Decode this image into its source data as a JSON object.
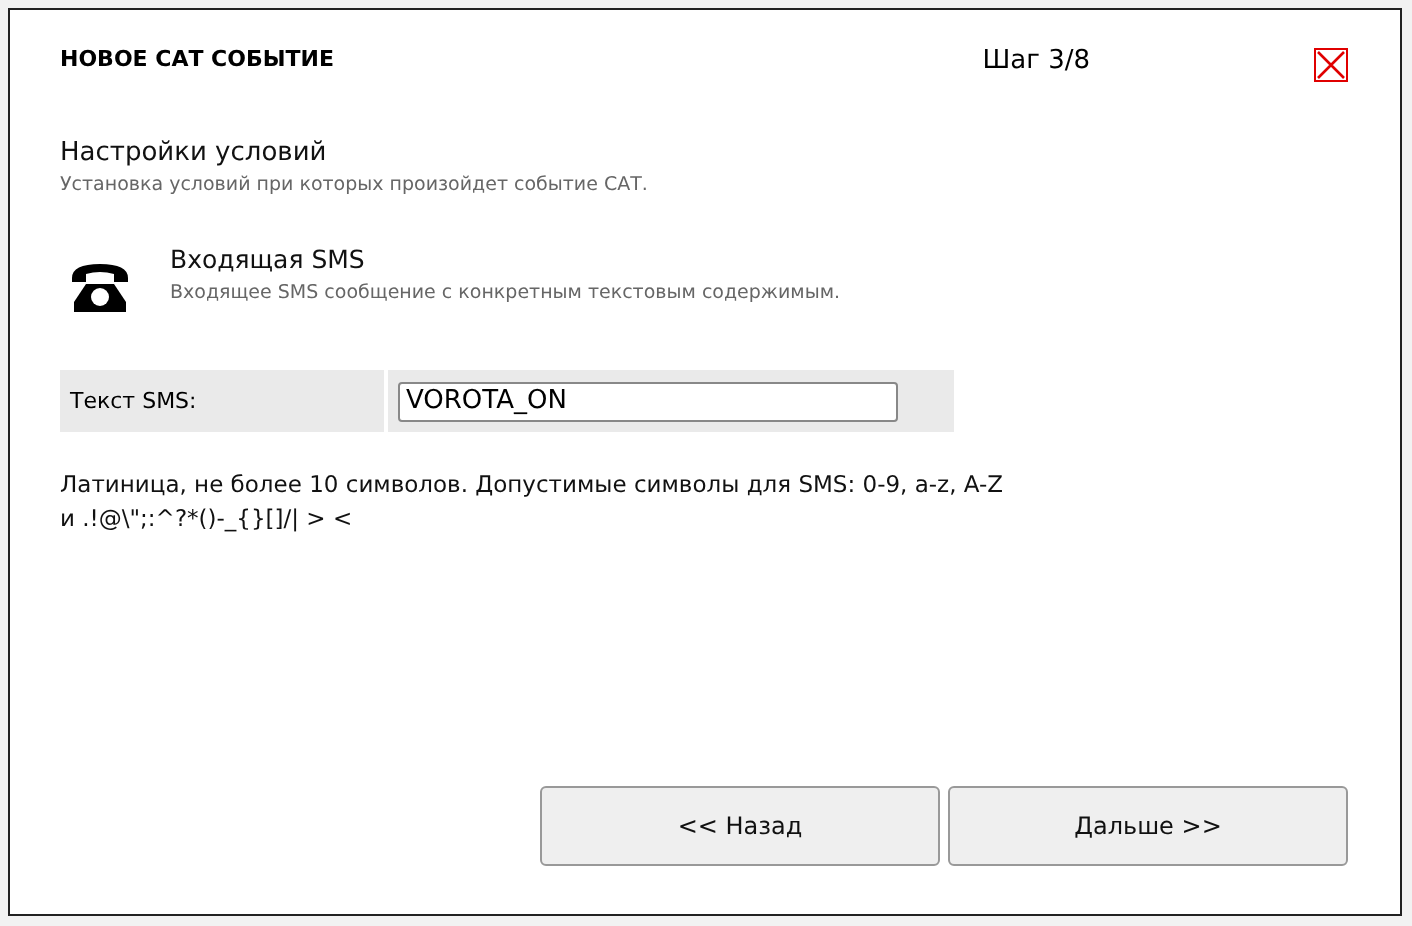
{
  "dialog": {
    "title": "НОВОЕ САТ СОБЫТИЕ",
    "step": "Шаг 3/8"
  },
  "section": {
    "title": "Настройки условий",
    "subtitle": "Установка условий при которых произойдет событие САТ."
  },
  "event": {
    "title": "Входящая SMS",
    "description": "Входящее SMS сообщение с конкретным текстовым содержимым."
  },
  "field": {
    "label": "Текст SMS:",
    "value": "VOROTA_ON"
  },
  "hint": [
    "Латиница, не более 10 символов. Допустимые символы для SMS: 0-9, a-z, A-Z",
    "и .!@\\\";:^?*()-_{}[]/| > <"
  ],
  "buttons": [
    "<< Назад",
    "Дальше >>"
  ]
}
